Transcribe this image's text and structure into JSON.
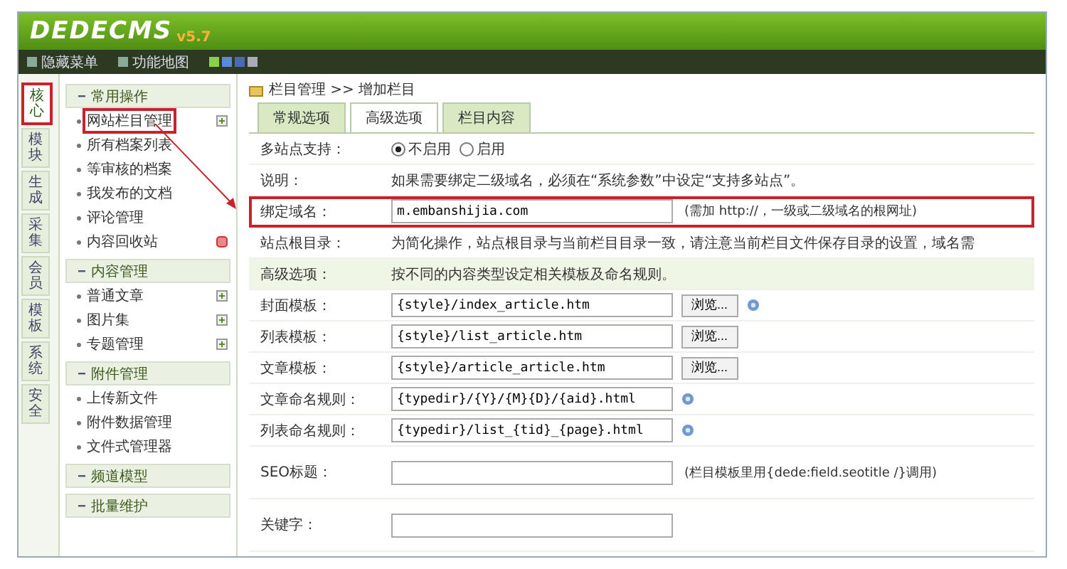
{
  "header": {
    "logo": "DEDECMS",
    "version": "v5.7"
  },
  "toolbar": {
    "links": [
      "隐藏菜单",
      "功能地图"
    ]
  },
  "sidebar": {
    "tabs": [
      {
        "label": "核心",
        "selected": true,
        "annotated": true
      },
      {
        "label": "模块",
        "selected": false,
        "annotated": false
      },
      {
        "label": "生成",
        "selected": false,
        "annotated": false
      },
      {
        "label": "采集",
        "selected": false,
        "annotated": false
      },
      {
        "label": "会员",
        "selected": false,
        "annotated": false
      },
      {
        "label": "模板",
        "selected": false,
        "annotated": false
      },
      {
        "label": "系统",
        "selected": false,
        "annotated": false
      },
      {
        "label": "安全",
        "selected": false,
        "annotated": false
      }
    ],
    "sections": [
      {
        "title": "常用操作",
        "items": [
          {
            "label": "网站栏目管理",
            "annotated": true,
            "kind": "add"
          },
          {
            "label": "所有档案列表",
            "annotated": false
          },
          {
            "label": "等审核的档案",
            "annotated": false
          },
          {
            "label": "我发布的文档",
            "annotated": false
          },
          {
            "label": "评论管理",
            "annotated": false
          },
          {
            "label": "内容回收站",
            "annotated": false,
            "kind": "alert"
          }
        ]
      },
      {
        "title": "内容管理",
        "items": [
          {
            "label": "普通文章",
            "annotated": false,
            "kind": "add"
          },
          {
            "label": "图片集",
            "annotated": false,
            "kind": "add"
          },
          {
            "label": "专题管理",
            "annotated": false,
            "kind": "add"
          }
        ]
      },
      {
        "title": "附件管理",
        "items": [
          {
            "label": "上传新文件",
            "annotated": false
          },
          {
            "label": "附件数据管理",
            "annotated": false
          },
          {
            "label": "文件式管理器",
            "annotated": false
          }
        ]
      },
      {
        "title": "频道模型"
      },
      {
        "title": "批量维护"
      }
    ]
  },
  "main": {
    "breadcrumb": "栏目管理 >> 增加栏目",
    "tabs": [
      {
        "label": "常规选项",
        "selected": false
      },
      {
        "label": "高级选项",
        "selected": true
      },
      {
        "label": "栏目内容",
        "selected": false
      }
    ],
    "rows": [
      {
        "kind": "radio",
        "label": "多站点支持：",
        "options": [
          {
            "label": "不启用",
            "selected": true
          },
          {
            "label": "启用",
            "selected": false
          }
        ]
      },
      {
        "kind": "note",
        "label": "说明：",
        "text": "如果需要绑定二级域名，必须在“系统参数”中设定“支持多站点”。"
      },
      {
        "kind": "field",
        "label": "绑定域名：",
        "value": "m.embanshijia.com",
        "hint": "(需加 http://，一级或二级域名的根网址)",
        "annotated": true
      },
      {
        "kind": "note",
        "label": "站点根目录：",
        "text": "为简化操作，站点根目录与当前栏目目录一致，请注意当前栏目文件保存目录的设置，域名需"
      },
      {
        "kind": "section",
        "label": "高级选项：",
        "text": "按不同的内容类型设定相关模板及命名规则。"
      },
      {
        "kind": "field",
        "label": "封面模板：",
        "value": "{style}/index_article.htm",
        "button": "浏览...",
        "help": true
      },
      {
        "kind": "field",
        "label": "列表模板：",
        "value": "{style}/list_article.htm",
        "button": "浏览..."
      },
      {
        "kind": "field",
        "label": "文章模板：",
        "value": "{style}/article_article.htm",
        "button": "浏览..."
      },
      {
        "kind": "field",
        "label": "文章命名规则：",
        "value": "{typedir}/{Y}/{M}{D}/{aid}.html",
        "help": true
      },
      {
        "kind": "field",
        "label": "列表命名规则：",
        "value": "{typedir}/list_{tid}_{page}.html",
        "help": true
      },
      {
        "kind": "tall",
        "label": "SEO标题：",
        "value": "",
        "hint": "(栏目模板里用{dede:field.seotitle /}调用)"
      },
      {
        "kind": "tall",
        "label": "关键字：",
        "value": ""
      }
    ]
  }
}
